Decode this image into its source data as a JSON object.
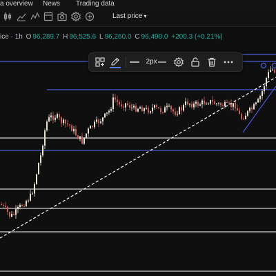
{
  "topnav": {
    "items": [
      {
        "label": "a overview"
      },
      {
        "label": "News"
      },
      {
        "label": "Trading data"
      }
    ]
  },
  "toolbar": {
    "icons": [
      "candles-icon",
      "line-chart-icon",
      "indicators-icon",
      "camera-icon",
      "settings-icon",
      "add-icon"
    ],
    "last_price_label": "Last price",
    "last_price_caret": "▾"
  },
  "legend": {
    "symbol": "ice · 1h",
    "open_label": "O",
    "open": "96,289.7",
    "high_label": "H",
    "high": "96,525.6",
    "low_label": "L",
    "low": "96,260.0",
    "close_label": "C",
    "close": "96,490.0",
    "change": "+200.3 (+0.21%)"
  },
  "drawing_toolbar": {
    "width_label": "2px",
    "line_color": "#5b7cf5",
    "icons": [
      "templates-icon",
      "pencil-icon",
      "line-style-icon",
      "settings-icon",
      "lock-icon",
      "trash-icon",
      "more-icon"
    ]
  },
  "colors": {
    "up": "#26a69a",
    "down": "#ef5350",
    "candle_up_body": "#e8e0d0",
    "candle_down_body": "#c0605a",
    "horizontal_line": "#ffffff",
    "blue_line": "#4a5ad8"
  }
}
